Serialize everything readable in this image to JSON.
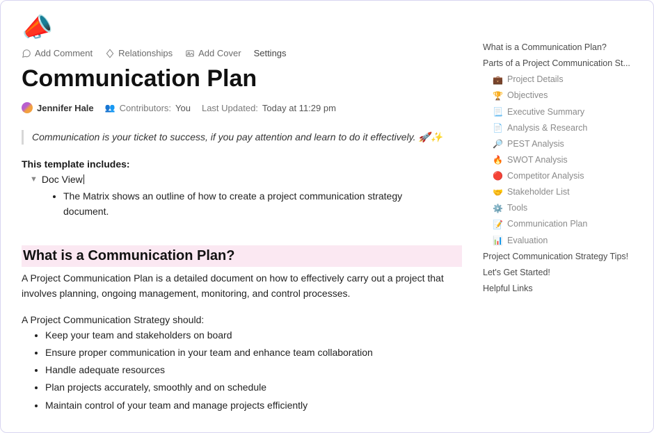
{
  "icon": "📣",
  "toolbar": {
    "add_comment": "Add Comment",
    "relationships": "Relationships",
    "add_cover": "Add Cover",
    "settings": "Settings"
  },
  "page_title": "Communication Plan",
  "meta": {
    "author": "Jennifer Hale",
    "contributors_label": "Contributors:",
    "contributors_value": "You",
    "updated_label": "Last Updated:",
    "updated_value": "Today at 11:29 pm"
  },
  "quote": "Communication is your ticket to success, if you pay attention and learn to do it effectively. 🚀✨",
  "includes_label": "This template includes:",
  "toggle": {
    "label": "Doc View",
    "item": "The Matrix shows an outline of how to create a project communication strategy document."
  },
  "section1": {
    "heading": "What is a Communication Plan?",
    "para": "A Project Communication Plan is a detailed document on how to effectively carry out a project that involves planning, ongoing management, monitoring, and control processes.",
    "lead": "A Project Communication Strategy should:",
    "bullets": [
      "Keep your team and stakeholders on board",
      "Ensure proper communication in your team and enhance team collaboration",
      "Handle adequate resources",
      "Plan projects accurately, smoothly and on schedule",
      "Maintain control of your team and manage projects efficiently"
    ]
  },
  "toc": {
    "top": [
      "What is a Communication Plan?",
      "Parts of a Project Communication St..."
    ],
    "sub": [
      {
        "emoji": "💼",
        "label": "Project Details"
      },
      {
        "emoji": "🏆",
        "label": "Objectives"
      },
      {
        "emoji": "📃",
        "label": "Executive Summary"
      },
      {
        "emoji": "📄",
        "label": "Analysis & Research"
      },
      {
        "emoji": "🔎",
        "label": "PEST Analysis"
      },
      {
        "emoji": "🔥",
        "label": "SWOT Analysis"
      },
      {
        "emoji": "🔴",
        "label": "Competitor Analysis"
      },
      {
        "emoji": "🤝",
        "label": "Stakeholder List"
      },
      {
        "emoji": "⚙️",
        "label": "Tools"
      },
      {
        "emoji": "📝",
        "label": "Communication Plan"
      },
      {
        "emoji": "📊",
        "label": "Evaluation"
      }
    ],
    "bottom": [
      "Project Communication Strategy Tips!",
      "Let's Get Started!",
      "Helpful Links"
    ]
  }
}
